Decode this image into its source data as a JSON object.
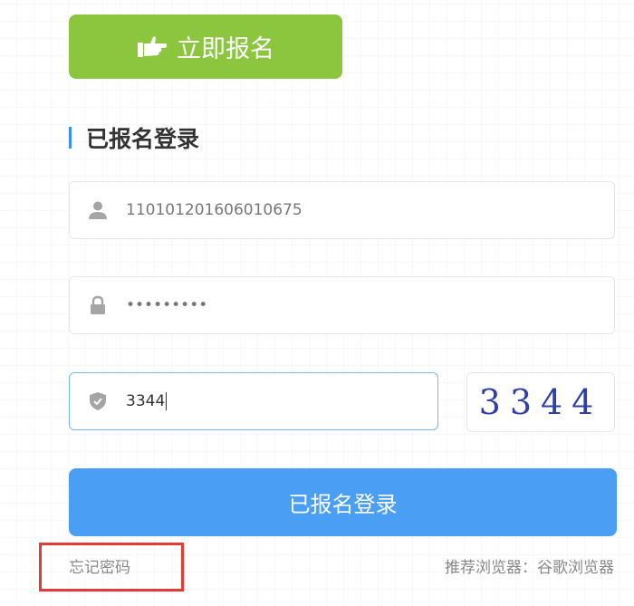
{
  "register_button": {
    "label": "立即报名",
    "icon": "pointing-hand-icon",
    "color": "#8cc63f"
  },
  "section": {
    "title": "已报名登录",
    "accent": "#3a91f0"
  },
  "username": {
    "icon": "user-icon",
    "value": "110101201606010675"
  },
  "password": {
    "icon": "lock-icon",
    "masked_value": "•••••••••"
  },
  "captcha": {
    "icon": "shield-icon",
    "value": "3344",
    "image_text": "3344"
  },
  "login_button": {
    "label": "已报名登录",
    "color": "#4a9ff5"
  },
  "forgot_password": {
    "label": "忘记密码",
    "highlight_color": "#e53935"
  },
  "browser_tip": {
    "label": "推荐浏览器：谷歌浏览器"
  }
}
